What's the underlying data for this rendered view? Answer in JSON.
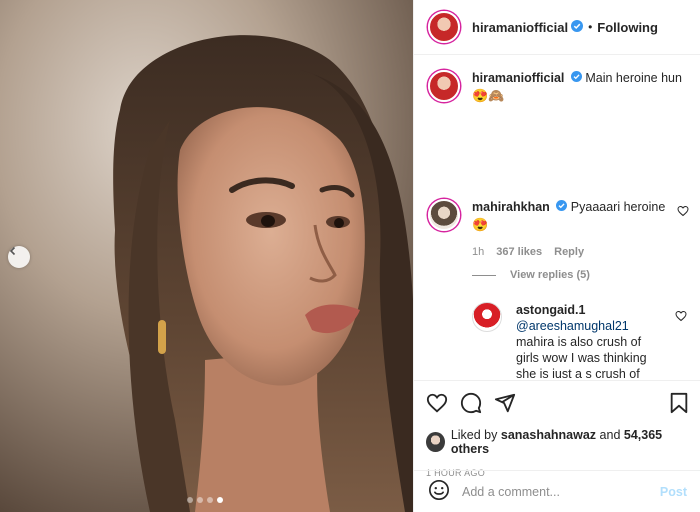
{
  "post": {
    "image_alt": "",
    "carousel_count": 4,
    "carousel_active": 3
  },
  "header": {
    "username": "hiramaniofficial",
    "separator": "•",
    "follow_status": "Following"
  },
  "caption": {
    "username": "hiramaniofficial",
    "text": "Main heroine hun",
    "emojis": "😍🙈"
  },
  "comments": [
    {
      "username": "mahirahkhan",
      "text": "Pyaaaari heroine",
      "emojis": "😍",
      "time": "1h",
      "likes": "367 likes",
      "reply_label": "Reply",
      "view_replies": "View replies (5)"
    }
  ],
  "reply": {
    "username": "astongaid.1",
    "mention": "@areeshamughal21",
    "text": "mahira is also crush of girls wow I was thinking she is just a s crush of"
  },
  "liked_by": {
    "prefix": "Liked by",
    "user": "sanashahnawaz",
    "conjunction": "and",
    "others": "54,365 others"
  },
  "timestamp": "1 HOUR AGO",
  "add_comment": {
    "placeholder": "Add a comment...",
    "post_label": "Post"
  },
  "colors": {
    "verified": "#3897f0",
    "link": "#00376b",
    "muted": "#8e8e8e",
    "post_disabled": "#b2dffc"
  },
  "icons": [
    "chevron-left-icon",
    "verified-icon",
    "heart-icon",
    "comment-icon",
    "share-icon",
    "bookmark-icon",
    "emoji-icon"
  ]
}
